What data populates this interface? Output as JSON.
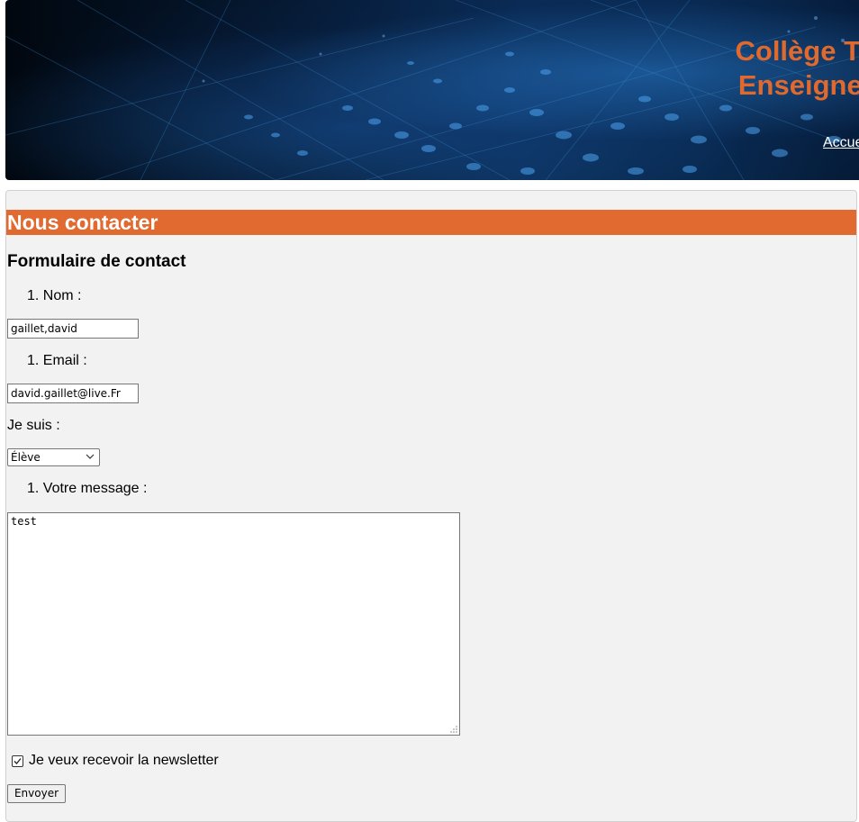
{
  "header": {
    "title_line1": "Collège Technique \"A",
    "title_line2": "Enseignement de F",
    "nav_link": "Accueil"
  },
  "section": {
    "title": "Nous contacter"
  },
  "form": {
    "heading": "Formulaire de contact",
    "fields": {
      "nom": {
        "label": "1. Nom :",
        "value": "gaillet,david"
      },
      "email": {
        "label": "1. Email :",
        "value": "david.gaillet@live.Fr"
      },
      "role": {
        "label": "Je suis :",
        "selected": "Élève"
      },
      "message": {
        "label": "1. Votre message :",
        "value": "test"
      }
    },
    "newsletter": {
      "label": "Je veux recevoir la newsletter",
      "checked": true
    },
    "submit_label": "Envoyer"
  },
  "colors": {
    "accent": "#e06a30",
    "title": "#e0692e",
    "panel": "#f2f2f2"
  }
}
